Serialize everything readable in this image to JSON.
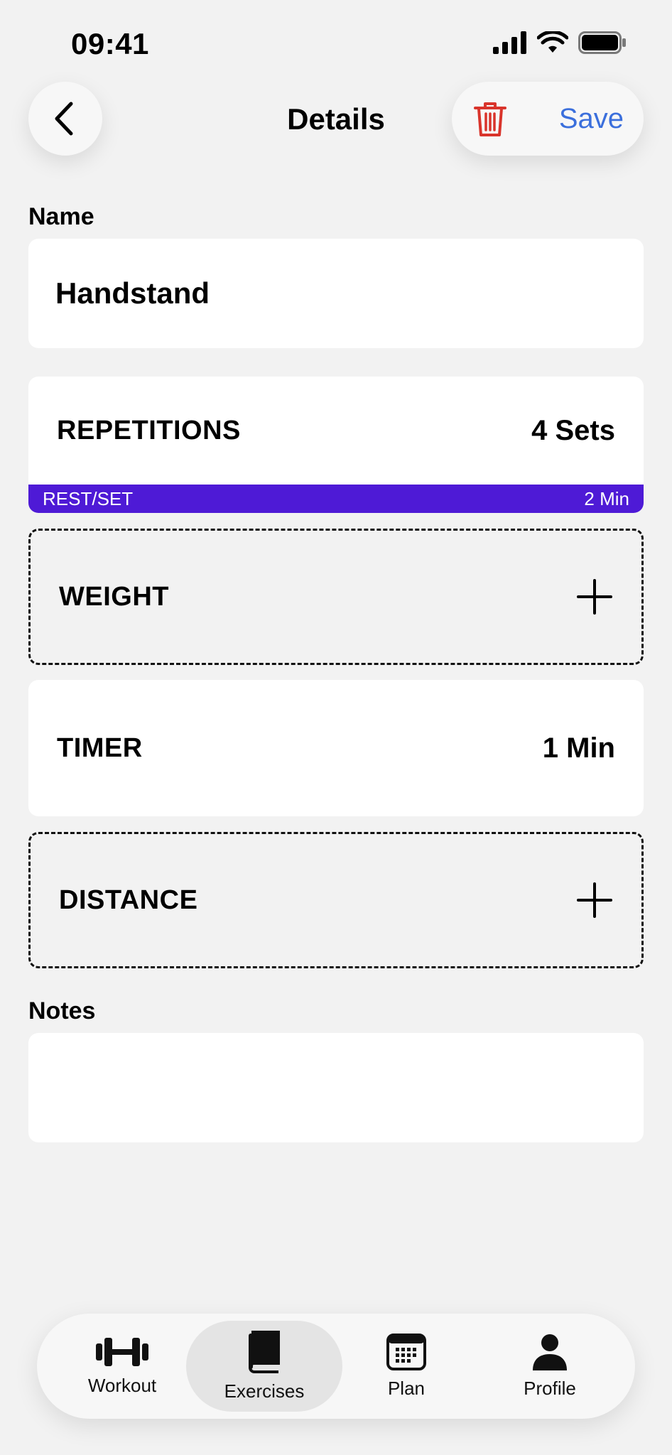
{
  "status_bar": {
    "time": "09:41"
  },
  "header": {
    "title": "Details",
    "save_label": "Save"
  },
  "name": {
    "label": "Name",
    "value": "Handstand"
  },
  "repetitions": {
    "label": "REPETITIONS",
    "value": "4 Sets",
    "rest_label": "REST/SET",
    "rest_value": "2 Min",
    "rest_color": "#4e1ad6"
  },
  "weight": {
    "label": "WEIGHT"
  },
  "timer": {
    "label": "TIMER",
    "value": "1 Min"
  },
  "distance": {
    "label": "DISTANCE"
  },
  "notes": {
    "label": "Notes",
    "value": ""
  },
  "tabs": [
    {
      "label": "Workout",
      "icon": "dumbbell-icon",
      "active": false
    },
    {
      "label": "Exercises",
      "icon": "book-icon",
      "active": true
    },
    {
      "label": "Plan",
      "icon": "calendar-icon",
      "active": false
    },
    {
      "label": "Profile",
      "icon": "person-icon",
      "active": false
    }
  ],
  "colors": {
    "accent": "#3b6fdc",
    "delete": "#d9342b",
    "background": "#f2f2f2"
  }
}
